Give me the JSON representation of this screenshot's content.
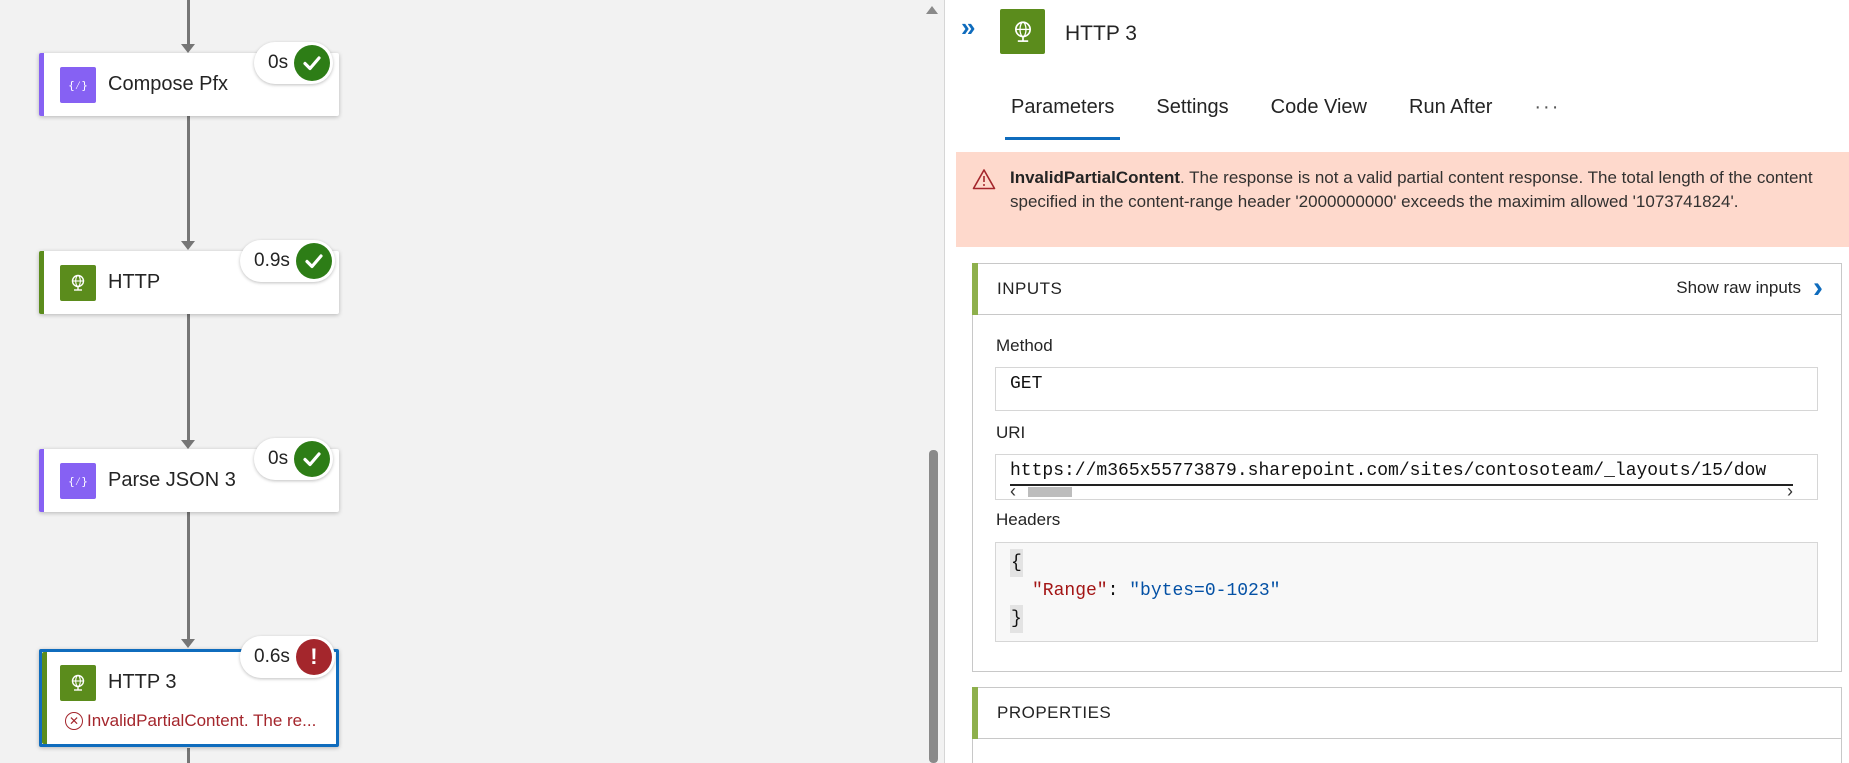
{
  "canvas": {
    "actions": [
      {
        "name": "Compose Pfx",
        "duration": "0s",
        "status": "succeeded",
        "type": "compose",
        "color": "#8661f3"
      },
      {
        "name": "HTTP",
        "duration": "0.9s",
        "status": "succeeded",
        "type": "http",
        "color": "#5b8c1c"
      },
      {
        "name": "Parse JSON 3",
        "duration": "0s",
        "status": "succeeded",
        "type": "compose",
        "color": "#8661f3"
      },
      {
        "name": "HTTP 3",
        "duration": "0.6s",
        "status": "failed",
        "type": "http",
        "color": "#5b8c1c",
        "error_preview": "InvalidPartialContent. The re..."
      }
    ]
  },
  "panel": {
    "title": "HTTP 3",
    "tabs": [
      "Parameters",
      "Settings",
      "Code View",
      "Run After",
      "···"
    ],
    "active_tab": "Parameters",
    "error": {
      "code": "InvalidPartialContent",
      "message": ". The response is not a valid partial content response. The total length of the content specified in the content-range header '2000000000' exceeds the maximim allowed '1073741824'."
    },
    "inputs": {
      "heading": "INPUTS",
      "show_raw_label": "Show raw inputs",
      "method_label": "Method",
      "method_value": "GET",
      "uri_label": "URI",
      "uri_value": "https://m365x55773879.sharepoint.com/sites/contosoteam/_layouts/15/dow",
      "headers_label": "Headers",
      "headers": {
        "open": "{",
        "key": "\"Range\"",
        "sep": ": ",
        "value": "\"bytes=0-1023\"",
        "close": "}"
      }
    },
    "properties": {
      "heading": "PROPERTIES"
    }
  },
  "colors": {
    "accent": "#0f6cbd",
    "success": "#2d7d16",
    "error": "#a4262c",
    "error_banner": "#fed9cc",
    "section_accent": "#8eb04c"
  }
}
